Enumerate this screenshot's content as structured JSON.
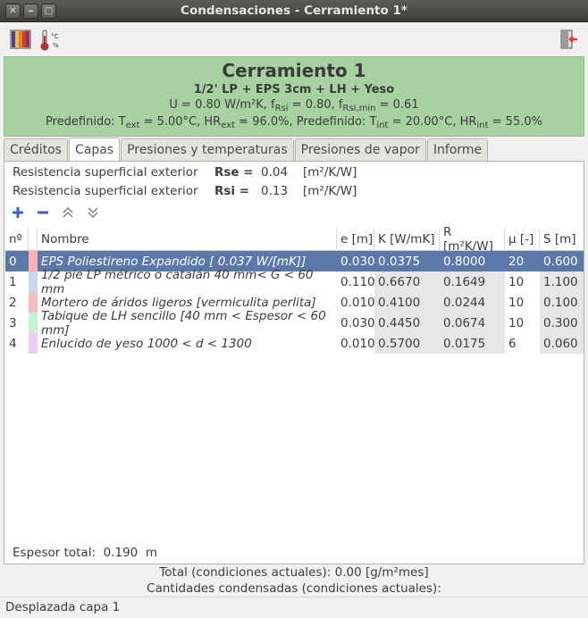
{
  "window": {
    "title": "Condensaciones - Cerramiento 1*"
  },
  "toolbar": {
    "icons": [
      "colors-icon",
      "thermometer-icon",
      "exit-icon"
    ],
    "thermo_label_top": "°C",
    "thermo_label_bottom": "%"
  },
  "banner": {
    "title": "Cerramiento 1",
    "subtitle": "1/2' LP + EPS 3cm + LH + Yeso",
    "u_prefix": "U = 0.80 W/m²K, f",
    "f_rsi_sub": "Rsi",
    "f_rsi_val": " = 0.80, f",
    "f_rsimin_sub": "Rsi,min",
    "f_rsimin_val": " = 0.61",
    "cond_1": "Predefinido: T",
    "text_sub": "ext",
    "cond_2": " = 5.00°C, HR",
    "hrext_sub": "ext",
    "cond_3": " = 96.0%, Predefinido: T",
    "tint_sub": "int",
    "cond_4": " = 20.00°C, HR",
    "hrint_sub": "int",
    "cond_5": " = 55.0%",
    "color": "#a7d1a1"
  },
  "tabs": [
    {
      "label": "Créditos",
      "active": false
    },
    {
      "label": "Capas",
      "active": true
    },
    {
      "label": "Presiones y temperaturas",
      "active": false
    },
    {
      "label": "Presiones de vapor",
      "active": false
    },
    {
      "label": "Informe",
      "active": false
    }
  ],
  "resistances": [
    {
      "label": "Resistencia superficial exterior",
      "symbol": "Rse =",
      "value": "0.04",
      "unit": "[m²/K/W]"
    },
    {
      "label": "Resistencia superficial exterior",
      "symbol": "Rsi =",
      "value": "0.13",
      "unit": "[m²/K/W]"
    }
  ],
  "layer_tools": [
    "add-icon",
    "remove-icon",
    "move-up-icon",
    "move-down-icon"
  ],
  "table": {
    "headers": {
      "no": "nº",
      "name": "Nombre",
      "e": "e [m]",
      "k": "K [W/mK]",
      "r": "R [m²K/W]",
      "mu": "μ [-]",
      "s": "S [m]"
    },
    "rows": [
      {
        "no": "0",
        "color": "#ffb0b0",
        "name": "EPS Poliestireno Expandido [ 0.037 W/[mK]]",
        "e": "0.030",
        "k": "0.0375",
        "r": "0.8000",
        "mu": "20",
        "s": "0.600",
        "selected": true
      },
      {
        "no": "1",
        "color": "#c8d8f4",
        "name": "1/2 pie LP métrico o catalán 40 mm< G < 60 mm",
        "e": "0.110",
        "k": "0.6670",
        "r": "0.1649",
        "mu": "10",
        "s": "1.100",
        "selected": false
      },
      {
        "no": "2",
        "color": "#f6bcbc",
        "name": "Mortero de áridos ligeros [vermiculita perlita]",
        "e": "0.010",
        "k": "0.4100",
        "r": "0.0244",
        "mu": "10",
        "s": "0.100",
        "selected": false
      },
      {
        "no": "3",
        "color": "#c6f2cf",
        "name": "Tabique de LH sencillo [40 mm < Espesor < 60 mm]",
        "e": "0.030",
        "k": "0.4450",
        "r": "0.0674",
        "mu": "10",
        "s": "0.300",
        "selected": false
      },
      {
        "no": "4",
        "color": "#eccdf6",
        "name": "Enlucido de yeso 1000 < d < 1300",
        "e": "0.010",
        "k": "0.5700",
        "r": "0.0175",
        "mu": "6",
        "s": "0.060",
        "selected": false
      }
    ]
  },
  "espesor": {
    "label": "Espesor total:",
    "value": "0.190",
    "unit": "m"
  },
  "footer": {
    "total": "Total (condiciones actuales): 0.00 [g/m²mes]",
    "condensed": "Cantidades condensadas (condiciones actuales):"
  },
  "status": {
    "text": "Desplazada capa 1"
  }
}
